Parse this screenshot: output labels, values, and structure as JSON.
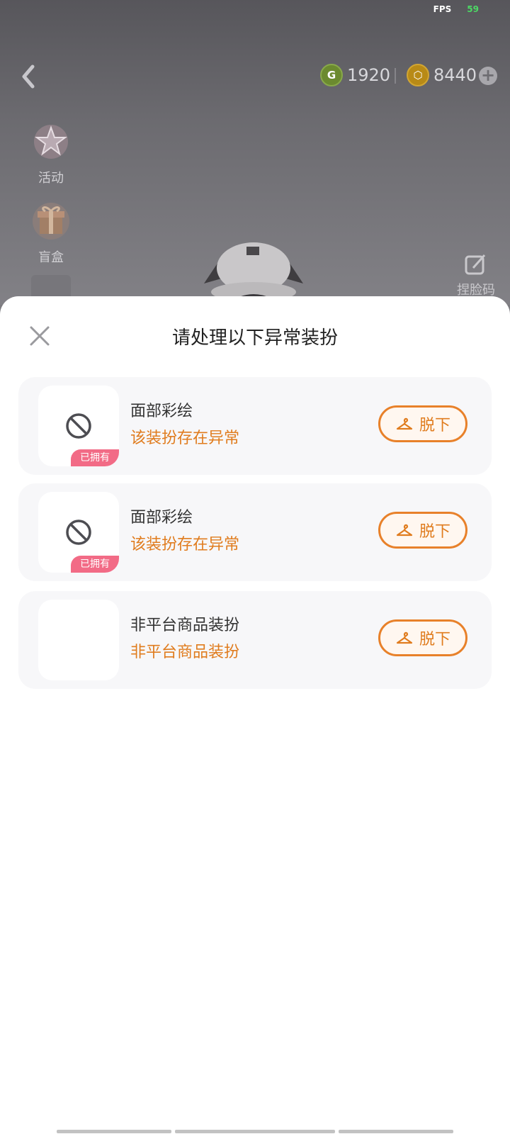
{
  "status": {
    "fps_label": "FPS",
    "fps_value": "59"
  },
  "header": {
    "currency_green": {
      "symbol": "G",
      "amount": "1920"
    },
    "currency_gold": {
      "symbol": "⬡",
      "amount": "8440"
    }
  },
  "sidebar": {
    "items": [
      {
        "label": "活动",
        "icon": "star-badge-icon"
      },
      {
        "label": "盲盒",
        "icon": "gift-box-icon"
      }
    ]
  },
  "face_button": {
    "label": "捏脸码"
  },
  "modal": {
    "title": "请处理以下异常装扮",
    "items": [
      {
        "name": "面部彩绘",
        "status": "该装扮存在异常",
        "badge": "已拥有",
        "action": "脱下"
      },
      {
        "name": "面部彩绘",
        "status": "该装扮存在异常",
        "badge": "已拥有",
        "action": "脱下"
      },
      {
        "name": "非平台商品装扮",
        "status": "非平台商品装扮",
        "action": "脱下"
      }
    ]
  },
  "colors": {
    "accent": "#e07c1e",
    "badge": "#f26b86"
  }
}
